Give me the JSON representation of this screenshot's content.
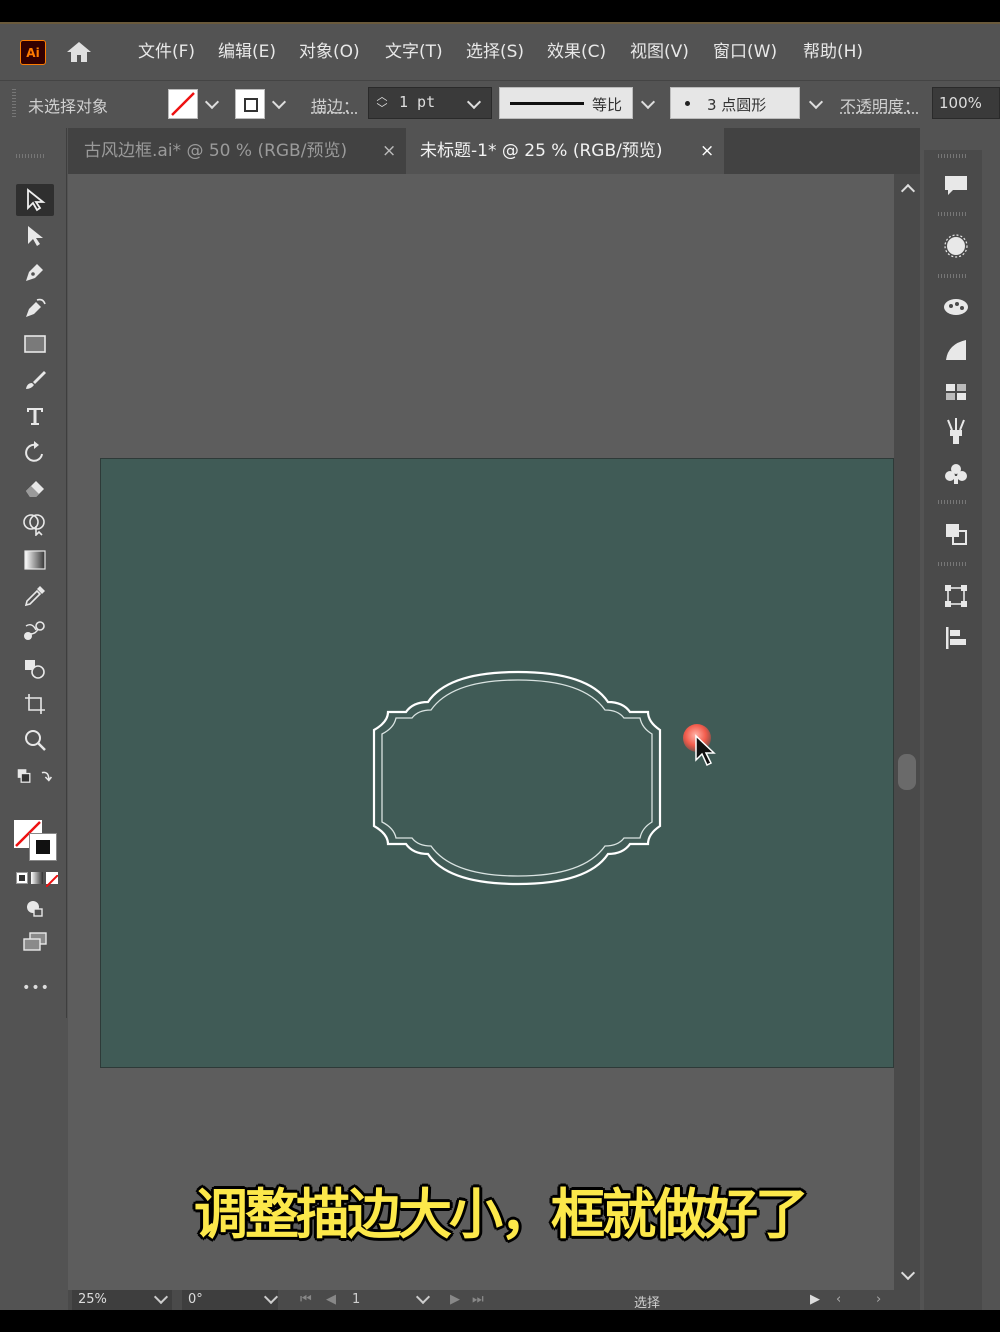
{
  "app": {
    "logo": "Ai"
  },
  "menu": [
    "文件(F)",
    "编辑(E)",
    "对象(O)",
    "文字(T)",
    "选择(S)",
    "效果(C)",
    "视图(V)",
    "窗口(W)",
    "帮助(H)"
  ],
  "control_bar": {
    "selection_status": "未选择对象",
    "stroke_label": "描边：",
    "stroke_weight": "1 pt",
    "stroke_profile": "等比",
    "brush": "3 点圆形",
    "opacity_label": "不透明度：",
    "opacity_value": "100%"
  },
  "tabs": [
    {
      "label": "古风边框.ai* @ 50 % (RGB/预览)",
      "close": "×",
      "active": false
    },
    {
      "label": "未标题-1* @ 25 % (RGB/预览)",
      "close": "×",
      "active": true
    }
  ],
  "tools": [
    "selection-tool-icon",
    "direct-selection-tool-icon",
    "pen-tool-icon",
    "curvature-tool-icon",
    "rectangle-tool-icon",
    "paintbrush-tool-icon",
    "type-tool-icon",
    "rotate-tool-icon",
    "eraser-tool-icon",
    "shape-builder-tool-icon",
    "gradient-tool-icon",
    "eyedropper-tool-icon",
    "blend-tool-icon",
    "symbol-sprayer-tool-icon",
    "artboard-tool-icon",
    "zoom-tool-icon"
  ],
  "toolbar_more": "•••",
  "panel_icons": [
    "comments-icon",
    "color-icon",
    "color-guide-icon",
    "gradient-panel-icon",
    "swatches-icon",
    "brushes-icon",
    "symbols-icon",
    "pathfinder-icon",
    "transform-icon",
    "align-icon"
  ],
  "status_bar": {
    "zoom": "25%",
    "rotation": "0°",
    "artboard_number": "1",
    "tool_status": "选择"
  },
  "subtitle": "调整描边大小，框就做好了",
  "colors": {
    "ui_bg": "#535353",
    "canvas": "#5d5d5d",
    "artboard": "#405b56",
    "frame_stroke": "#ffffff",
    "subtitle": "#fce84a",
    "logo_accent": "#ff7c00"
  }
}
